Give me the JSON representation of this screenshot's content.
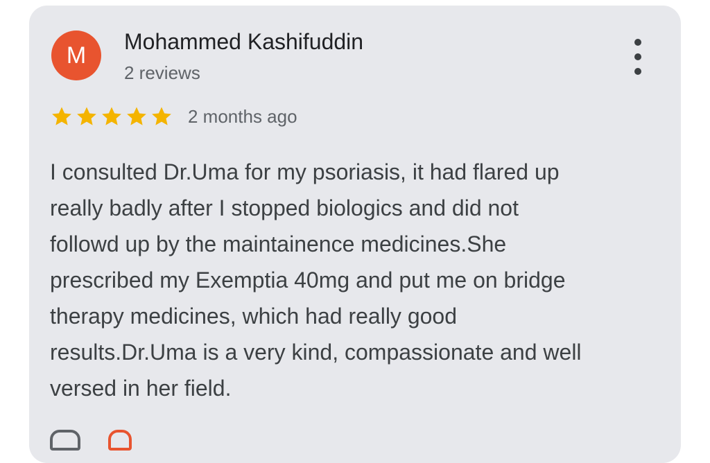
{
  "review": {
    "avatar_letter": "M",
    "avatar_color": "#e8542f",
    "author": "Mohammed Kashifuddin",
    "author_meta": "2 reviews",
    "rating": 5,
    "rating_max": 5,
    "star_color": "#f4b400",
    "date": "2 months ago",
    "text_lines": [
      "I consulted Dr.Uma for my psoriasis, it had flared up",
      "really badly after I stopped biologics and did not",
      "followd up by the maintainence medicines.She",
      "prescribed my Exemptia 40mg and put me on bridge",
      "therapy medicines, which had really good",
      "results.Dr.Uma is a very kind, compassionate and well",
      "versed in her field."
    ]
  },
  "icons": {
    "more": "more-vert-icon",
    "star": "star-icon",
    "like": "thumb-up-icon",
    "share": "share-icon"
  }
}
